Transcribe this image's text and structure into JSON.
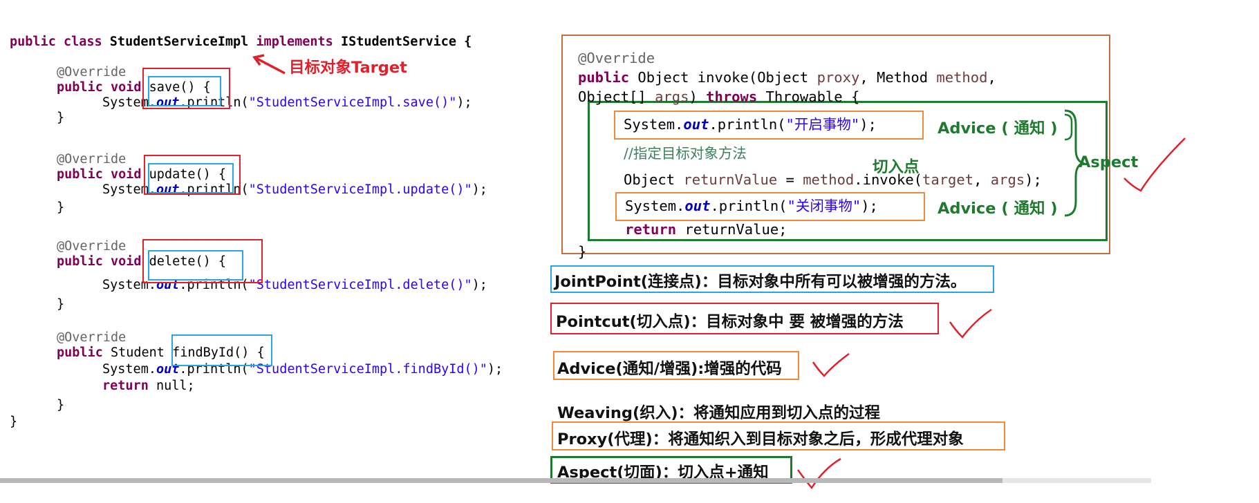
{
  "left_code": {
    "class_decl": {
      "kw1": "public class",
      "name": " StudentServiceImpl ",
      "kw2": "implements",
      "rest": " IStudentService {"
    },
    "methods": [
      {
        "annotation": "@Override",
        "kw": "public void",
        "sig": " save() {",
        "body_pre": "System.",
        "body_out": "out",
        "body_mid": ".println(",
        "body_str": "\"StudentServiceImpl.save()\"",
        "body_end": ");",
        "close": "}"
      },
      {
        "annotation": "@Override",
        "kw": "public void",
        "sig": " update() {",
        "body_pre": "System.",
        "body_out": "out",
        "body_mid": ".println(",
        "body_str": "\"StudentServiceImpl.update()\"",
        "body_end": ");",
        "close": "}"
      },
      {
        "annotation": "@Override",
        "kw": "public void",
        "sig": " delete() {",
        "body_pre": "System.",
        "body_out": "out",
        "body_mid": ".println(",
        "body_str": "\"StudentServiceImpl.delete()\"",
        "body_end": ");",
        "close": "}"
      },
      {
        "annotation": "@Override",
        "kw": "public",
        "sig": " Student findById() {",
        "body_pre": "System.",
        "body_out": "out",
        "body_mid": ".println(",
        "body_str": "\"StudentServiceImpl.findById()\"",
        "body_end": ");",
        "ret_kw": "return",
        "ret_rest": " null;",
        "close": "}"
      }
    ],
    "class_close": "}",
    "target_label": "目标对象Target"
  },
  "right_code": {
    "annotation": "@Override",
    "line1_kw": "public",
    "line1_a": " Object invoke(Object ",
    "line1_p1": "proxy",
    "line1_b": ", Method ",
    "line1_p2": "method",
    "line1_c": ",",
    "line2_a": "Object[] ",
    "line2_p": "args",
    "line2_b": ") ",
    "line2_kw": "throws",
    "line2_c": " Throwable {",
    "open_pre": "System.",
    "open_out": "out",
    "open_mid": ".println(",
    "open_str": "\"开启事物\"",
    "open_end": ");",
    "comment": "//指定目标对象方法",
    "invoke_a": "Object ",
    "invoke_var": "returnValue",
    "invoke_b": " = ",
    "invoke_c": "method",
    "invoke_d": ".invoke(",
    "invoke_e": "target",
    "invoke_f": ", ",
    "invoke_g": "args",
    "invoke_h": ");",
    "close_pre": "System.",
    "close_out": "out",
    "close_mid": ".println(",
    "close_str": "\"关闭事物\"",
    "close_end": ");",
    "ret_kw": "return",
    "ret_rest": " returnValue;",
    "brace_close": "}"
  },
  "labels": {
    "advice_top": "Advice ( 通知 )",
    "advice_bottom": "Advice ( 通知 )",
    "pointcut": "切入点",
    "aspect": "Aspect"
  },
  "definitions": [
    {
      "text": "JointPoint(连接点)：目标对象中所有可以被增强的方法。",
      "box": "blue"
    },
    {
      "text": "Pointcut(切入点)：目标对象中 要 被增强的方法",
      "box": "red"
    },
    {
      "text": "Advice(通知/增强):增强的代码",
      "box": "orange"
    },
    {
      "text": "Weaving(织入)：将通知应用到切入点的过程",
      "box": "none"
    },
    {
      "text": "Proxy(代理)：将通知织入到目标对象之后，形成代理对象",
      "box": "orange"
    },
    {
      "text": "Aspect(切面)：切入点+通知",
      "box": "green"
    }
  ],
  "colors": {
    "red": "#e0202a",
    "blue": "#2aa4e0",
    "orange": "#f08a3a",
    "green": "#1e7a2e",
    "keyword": "#7f0055"
  }
}
